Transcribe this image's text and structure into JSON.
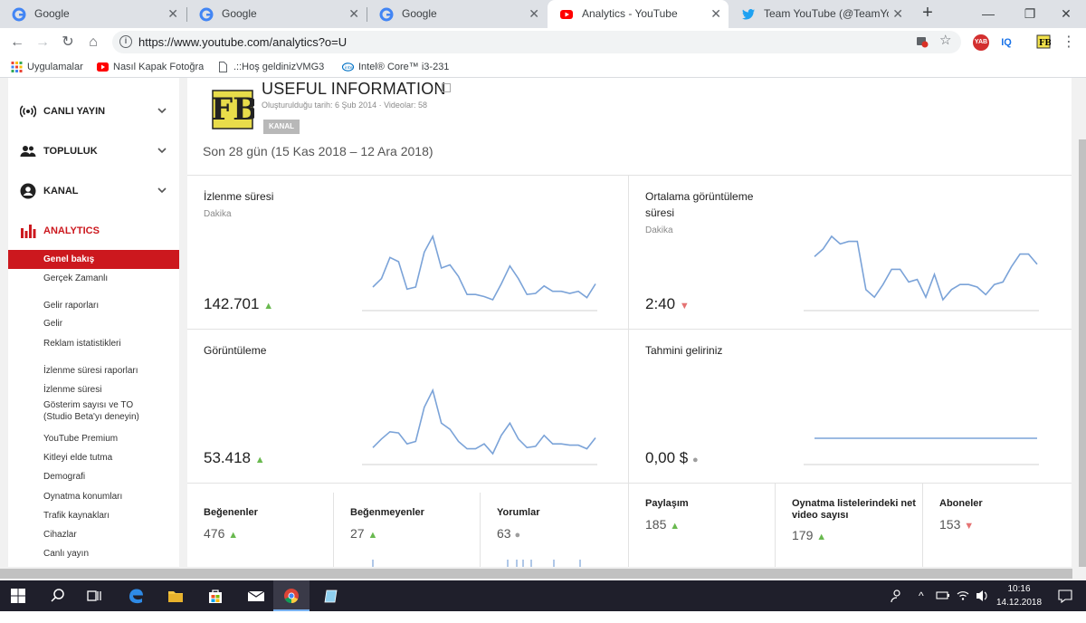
{
  "browser": {
    "tabs": [
      {
        "title": "Google",
        "active": false
      },
      {
        "title": "Google",
        "active": false
      },
      {
        "title": "Google",
        "active": false
      },
      {
        "title": "Analytics - YouTube",
        "active": true
      },
      {
        "title": "Team YouTube (@TeamYouTube",
        "active": false
      }
    ],
    "url": "https://www.youtube.com/analytics?o=U",
    "extensions": [
      "YAB",
      "IQ"
    ],
    "bookmarks": [
      {
        "label": "Uygulamalar",
        "icon": "apps-grid-icon"
      },
      {
        "label": "Nasıl Kapak Fotoğraf",
        "icon": "youtube-icon"
      },
      {
        "label": ".::Hoş geldinizVMG33",
        "icon": "page-icon"
      },
      {
        "label": "Intel® Core™ i3-231",
        "icon": "intel-icon"
      }
    ]
  },
  "sidebar": {
    "sections": [
      {
        "label": "CANLI YAYIN",
        "icon": "live-broadcast-icon"
      },
      {
        "label": "TOPLULUK",
        "icon": "community-icon"
      },
      {
        "label": "KANAL",
        "icon": "channel-icon"
      },
      {
        "label": "ANALYTICS",
        "icon": "analytics-bars-icon"
      }
    ],
    "items": [
      {
        "label": "Genel bakış",
        "active": true
      },
      {
        "label": "Gerçek Zamanlı"
      },
      {
        "label": "Gelir raporları"
      },
      {
        "label": "Gelir"
      },
      {
        "label": "Reklam istatistikleri"
      },
      {
        "label": "İzlenme süresi raporları"
      },
      {
        "label": "İzlenme süresi"
      },
      {
        "label": "Gösterim sayısı ve TO"
      },
      {
        "label": "(Studio Beta'yı deneyin)"
      },
      {
        "label": "YouTube Premium"
      },
      {
        "label": "Kitleyi elde tutma"
      },
      {
        "label": "Demografi"
      },
      {
        "label": "Oynatma konumları"
      },
      {
        "label": "Trafik kaynakları"
      },
      {
        "label": "Cihazlar"
      },
      {
        "label": "Canlı yayın"
      }
    ]
  },
  "channel": {
    "logo_text": "FB",
    "name": "USEFUL INFORMATION",
    "meta": "Oluşturulduğu tarih: 6 Şub 2014  ·  Videolar: 58",
    "badge": "KANAL",
    "period": "Son 28 gün (15 Kas 2018 – 12 Ara 2018)"
  },
  "metrics": [
    {
      "title": "İzlenme süresi",
      "unit": "Dakika",
      "value": "142.701",
      "trend": "up",
      "series": [
        52,
        60,
        80,
        76,
        50,
        52,
        85,
        100,
        70,
        73,
        62,
        45,
        45,
        43,
        40,
        55,
        72,
        60,
        45,
        46,
        53,
        48,
        48,
        46,
        48,
        42,
        55
      ]
    },
    {
      "title": "Ortalama görüntüleme süresi",
      "unit": "Dakika",
      "value": "2:40",
      "trend": "down",
      "series": [
        71,
        74,
        79,
        76,
        77,
        77,
        58,
        55,
        60,
        66,
        66,
        61,
        62,
        55,
        64,
        54,
        58,
        60,
        60,
        59,
        56,
        60,
        61,
        67,
        72,
        72,
        68
      ]
    },
    {
      "title": "Görüntüleme",
      "unit": "",
      "value": "53.418",
      "trend": "up",
      "series": [
        45,
        52,
        58,
        57,
        48,
        50,
        78,
        92,
        65,
        60,
        50,
        44,
        44,
        48,
        40,
        55,
        65,
        52,
        45,
        46,
        55,
        48,
        48,
        47,
        47,
        44,
        53
      ]
    },
    {
      "title": "Tahmini geliriniz",
      "unit": "",
      "value": "0,00 $",
      "trend": "flat",
      "series": [
        0,
        0,
        0,
        0,
        0,
        0,
        0,
        0,
        0,
        0,
        0,
        0,
        0,
        0,
        0,
        0,
        0,
        0,
        0,
        0,
        0,
        0,
        0,
        0,
        0,
        0,
        0
      ]
    }
  ],
  "mini_metrics": [
    {
      "title": "Beğenenler",
      "value": "476",
      "trend": "up"
    },
    {
      "title": "Beğenmeyenler",
      "value": "27",
      "trend": "up"
    },
    {
      "title": "Yorumlar",
      "value": "63",
      "trend": "flat"
    },
    {
      "title": "Paylaşım",
      "value": "185",
      "trend": "up"
    },
    {
      "title": "Oynatma listelerindeki net video sayısı",
      "value": "179",
      "trend": "up"
    },
    {
      "title": "Aboneler",
      "value": "153",
      "trend": "down"
    }
  ],
  "taskbar": {
    "time": "10:16",
    "date": "14.12.2018"
  },
  "colors": {
    "accent_red": "#cc181e",
    "spark_blue": "#7ba3d8",
    "trend_up": "#69b94f",
    "trend_down": "#e57373"
  }
}
